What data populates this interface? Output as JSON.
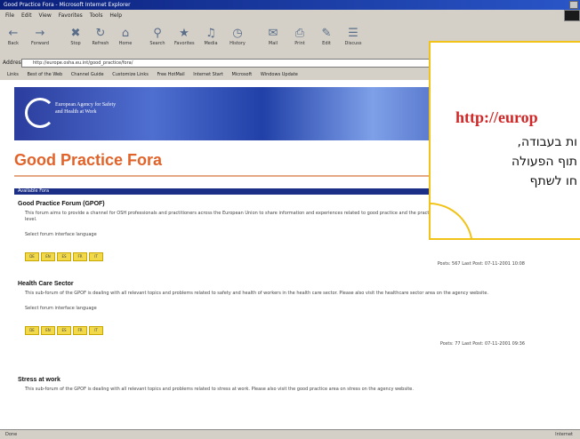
{
  "window": {
    "title": "Good Practice Fora - Microsoft Internet Explorer"
  },
  "menubar": [
    "File",
    "Edit",
    "View",
    "Favorites",
    "Tools",
    "Help"
  ],
  "toolbar": [
    "Back",
    "Forward",
    "Stop",
    "Refresh",
    "Home",
    "Search",
    "Favorites",
    "Media",
    "History",
    "Mail",
    "Print",
    "Edit",
    "Discuss"
  ],
  "address": {
    "label": "Address",
    "url": "http://europe.osha.eu.int/good_practice/fora/"
  },
  "links_bar": [
    "Links",
    "Best of the Web",
    "Channel Guide",
    "Customize Links",
    "Free HotMail",
    "Internet Start",
    "Microsoft",
    "Windows Update"
  ],
  "banner": {
    "agency_text": "European Agency for Safety and Health at Work"
  },
  "page": {
    "title": "Good Practice Fora",
    "section_header": "Available Fora"
  },
  "forums": [
    {
      "title": "Good Practice Forum (GPOF)",
      "description": "This forum aims to provide a channel for OSH professionals and practitioners across the European Union to share information and experiences related to good practice and the practical implementation of OSH at enterprise level.",
      "select_text": "Select forum interface language",
      "languages": [
        "DE",
        "EN",
        "ES",
        "FR",
        "IT"
      ],
      "stats": "Posts: 567   Last Post: 07-11-2001 10:08"
    },
    {
      "title": "Health Care Sector",
      "description": "This sub-forum of the GPOF is dealing with all relevant topics and problems related to safety and health of workers in the health care sector. Please also visit the healthcare sector area on the agency website.",
      "select_text": "Select forum interface language",
      "languages": [
        "DE",
        "EN",
        "ES",
        "FR",
        "IT"
      ],
      "stats": "Posts: 77   Last Post: 07-11-2001 09:36"
    },
    {
      "title": "Stress at work",
      "description": "This sub-forum of the GPOF is dealing with all relevant topics and problems related to stress at work. Please also visit the good practice area on stress on the agency website.",
      "select_text": "",
      "languages": [],
      "stats": ""
    }
  ],
  "statusbar": {
    "left": "Done",
    "right": "Internet"
  },
  "callout": {
    "url": "http://europ",
    "lines": [
      "ות בעבודה,",
      "תוף הפעולה",
      "חו לשתף"
    ]
  }
}
